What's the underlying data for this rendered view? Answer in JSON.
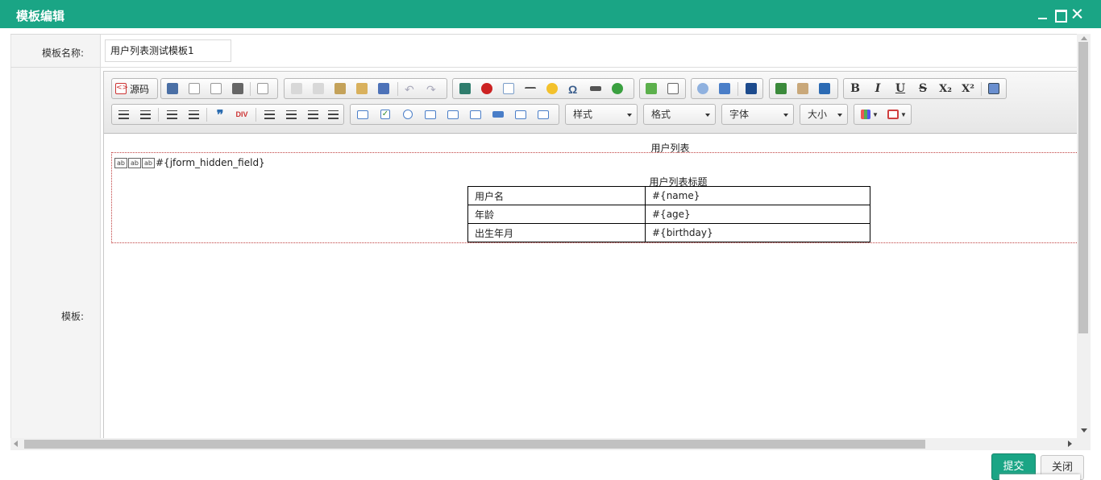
{
  "window": {
    "title": "模板编辑"
  },
  "form": {
    "name_label": "模板名称:",
    "name_value": "用户列表测试模板1",
    "template_label": "模板:"
  },
  "toolbar": {
    "source_label": "源码",
    "combos": {
      "style": "样式",
      "format": "格式",
      "font": "字体",
      "size": "大小"
    }
  },
  "document": {
    "title": "用户列表",
    "hidden_field_icon_text": "ab",
    "hidden_field_text": "#{jform_hidden_field}",
    "table_caption": "用户列表标题",
    "rows": [
      {
        "label": "用户名",
        "value": "#{name}"
      },
      {
        "label": "年龄",
        "value": "#{age}"
      },
      {
        "label": "出生年月",
        "value": "#{birthday}"
      }
    ]
  },
  "buttons": {
    "submit": "提交",
    "close": "关闭"
  },
  "colors": {
    "accent": "#1aa585"
  }
}
